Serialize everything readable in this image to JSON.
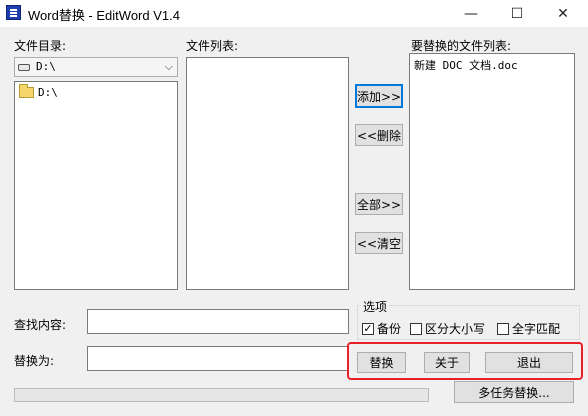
{
  "window": {
    "title": "Word替换 - EditWord V1.4",
    "controls": {
      "minimize": "—",
      "maximize": "☐",
      "close": "✕"
    }
  },
  "labels": {
    "file_dir": "文件目录:",
    "file_list": "文件列表:",
    "replace_list": "要替换的文件列表:",
    "find": "查找内容:",
    "replace_with": "替换为:",
    "options": "选项"
  },
  "drive_select": {
    "value": "D:\\",
    "icon": "drive-icon"
  },
  "dir_tree": {
    "items": [
      "D:\\"
    ]
  },
  "file_list": {
    "items": []
  },
  "replace_files": {
    "items": [
      "新建 DOC 文档.doc"
    ]
  },
  "buttons": {
    "add": "添加>>",
    "remove": "<<删除",
    "add_all": "全部>>",
    "clear": "<<清空",
    "replace": "替换",
    "about": "关于",
    "exit": "退出",
    "multitask": "多任务替换..."
  },
  "options": [
    {
      "label": "备份",
      "checked": true
    },
    {
      "label": "区分大小写",
      "checked": false
    },
    {
      "label": "全字匹配",
      "checked": false
    }
  ],
  "inputs": {
    "find_value": "",
    "replace_value": ""
  },
  "progress": {
    "value": 0
  },
  "colors": {
    "highlight": "#e8202a",
    "focus": "#0078d7",
    "app_icon": "#1f3fae"
  }
}
